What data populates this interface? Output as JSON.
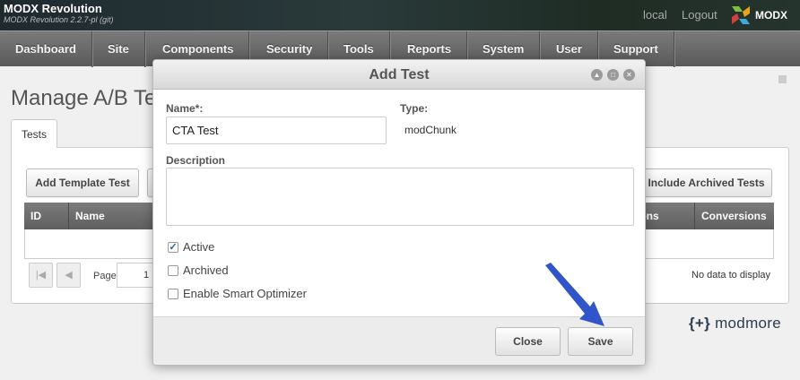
{
  "header": {
    "brand_title": "MODX Revolution",
    "brand_version": "MODX Revolution 2.2.7-pl (git)",
    "links": [
      "local",
      "Logout"
    ],
    "logo_text": "MODX"
  },
  "nav": [
    "Dashboard",
    "Site",
    "Components",
    "Security",
    "Tools",
    "Reports",
    "System",
    "User",
    "Support"
  ],
  "page": {
    "title": "Manage A/B Tests",
    "tab": "Tests",
    "toolbar": {
      "add_template_test": "Add Template Test",
      "include_archived": "Include Archived Tests"
    },
    "grid": {
      "columns": [
        "ID",
        "Name",
        "Conversions",
        "Conversions"
      ],
      "empty_text": "No data to display"
    },
    "pager": {
      "label": "Page",
      "value": "1"
    },
    "footer_brand": {
      "bracket": "{+}",
      "name": "modmore"
    }
  },
  "modal": {
    "title": "Add Test",
    "name_label": "Name*:",
    "name_value": "CTA Test",
    "type_label": "Type:",
    "type_value": "modChunk",
    "description_label": "Description",
    "description_value": "",
    "checkboxes": [
      {
        "label": "Active",
        "checked": true
      },
      {
        "label": "Archived",
        "checked": false
      },
      {
        "label": "Enable Smart Optimizer",
        "checked": false
      }
    ],
    "close_label": "Close",
    "save_label": "Save"
  },
  "colors": {
    "nav_bg": "#666666",
    "accent_arrow": "#2f55c8",
    "modal_bg": "#ffffff"
  }
}
